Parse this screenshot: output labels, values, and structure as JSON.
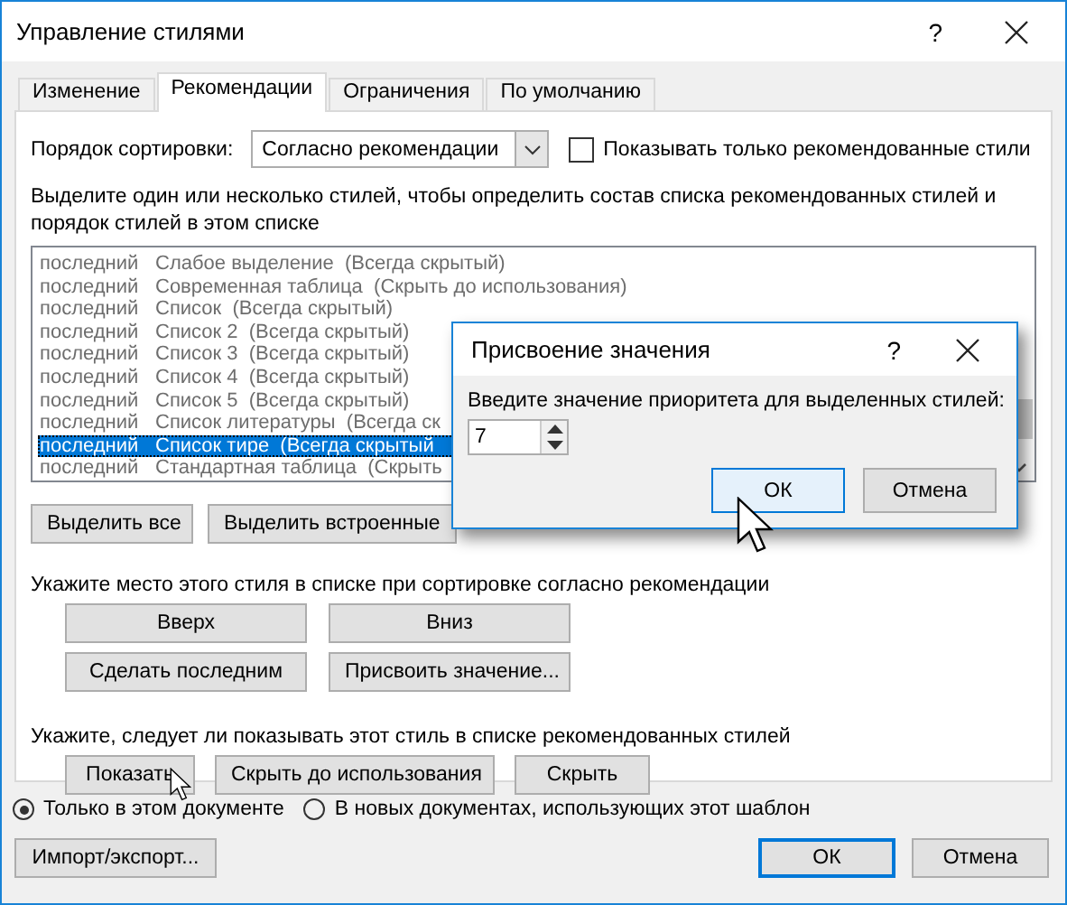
{
  "window": {
    "title": "Управление стилями",
    "help": "?"
  },
  "tabs": [
    {
      "label": "Изменение",
      "selected": false
    },
    {
      "label": "Рекомендации",
      "selected": true
    },
    {
      "label": "Ограничения",
      "selected": false
    },
    {
      "label": "По умолчанию",
      "selected": false
    }
  ],
  "sort": {
    "label": "Порядок сортировки:",
    "value": "Согласно рекомендации"
  },
  "recommended_only": {
    "label": "Показывать только рекомендованные стили",
    "checked": false
  },
  "instruction": "Выделите один или несколько стилей, чтобы определить состав списка рекомендованных стилей и порядок стилей в этом списке",
  "styles": [
    {
      "priority": "последний",
      "text": "Слабое выделение  (Всегда скрытый)",
      "selected": false
    },
    {
      "priority": "последний",
      "text": "Современная таблица  (Скрыть до использования)",
      "selected": false
    },
    {
      "priority": "последний",
      "text": "Список  (Всегда скрытый)",
      "selected": false
    },
    {
      "priority": "последний",
      "text": "Список 2  (Всегда скрытый)",
      "selected": false
    },
    {
      "priority": "последний",
      "text": "Список 3  (Всегда скрытый)",
      "selected": false
    },
    {
      "priority": "последний",
      "text": "Список 4  (Всегда скрытый)",
      "selected": false
    },
    {
      "priority": "последний",
      "text": "Список 5  (Всегда скрытый)",
      "selected": false
    },
    {
      "priority": "последний",
      "text": "Список литературы  (Всегда ск",
      "selected": false
    },
    {
      "priority": "последний",
      "text": "Список тире  (Всегда скрытый",
      "selected": true
    },
    {
      "priority": "последний",
      "text": "Стандартная таблица  (Скрыть",
      "selected": false
    }
  ],
  "select_buttons": [
    "Выделить все",
    "Выделить встроенные"
  ],
  "position_label": "Укажите место этого стиля в списке при сортировке согласно рекомендации",
  "position_buttons": [
    "Вверх",
    "Вниз",
    "Сделать последним",
    "Присвоить значение..."
  ],
  "visibility_label": "Укажите, следует ли показывать этот стиль в списке рекомендованных стилей",
  "visibility_buttons": [
    "Показать",
    "Скрыть до использования",
    "Скрыть"
  ],
  "scope": [
    {
      "label": "Только в этом документе",
      "selected": true
    },
    {
      "label": "В новых документах, использующих этот шаблон",
      "selected": false
    }
  ],
  "import_button": "Импорт/экспорт...",
  "ok": "ОК",
  "cancel": "Отмена",
  "dialog": {
    "title": "Присвоение значения",
    "help": "?",
    "label": "Введите значение приоритета для выделенных стилей:",
    "value": "7",
    "ok": "ОК",
    "cancel": "Отмена"
  }
}
